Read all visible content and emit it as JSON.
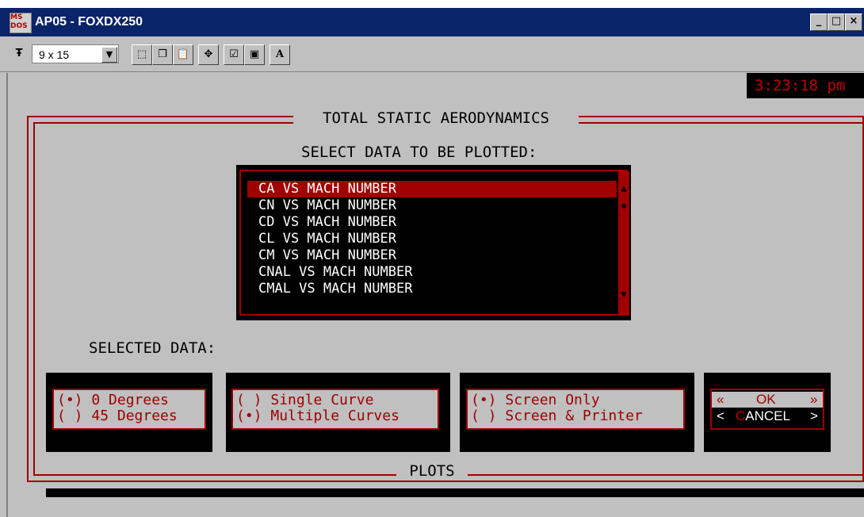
{
  "window": {
    "icon_text": "MS DOS",
    "title": "AP05 - FOXDX250",
    "controls": [
      "_",
      "□",
      "×"
    ]
  },
  "toolbar": {
    "font_icon": "Ŧ",
    "font_size": "9 x 15",
    "tools": [
      "select-icon",
      "copy-icon",
      "paste-icon",
      "fullscreen-icon",
      "properties-icon",
      "background-icon",
      "font-icon"
    ]
  },
  "clock": "3:23:18 pm",
  "dialog": {
    "title": "TOTAL STATIC AERODYNAMICS",
    "prompt": "SELECT DATA TO BE PLOTTED:",
    "list_items": [
      "CA VS MACH NUMBER",
      "CN VS MACH NUMBER",
      "CD VS MACH NUMBER",
      "CL VS MACH NUMBER",
      "CM VS MACH NUMBER",
      "CNAL VS MACH NUMBER",
      "CMAL VS MACH NUMBER"
    ],
    "selected_index": 0,
    "selected_data_label": "SELECTED DATA:",
    "angle_options": [
      {
        "marker": "(•)",
        "label": "0 Degrees"
      },
      {
        "marker": "( )",
        "label": "45 Degrees"
      }
    ],
    "curve_options": [
      {
        "marker": "( )",
        "label": "Single Curve"
      },
      {
        "marker": "(•)",
        "label": "Multiple Curves"
      }
    ],
    "output_options": [
      {
        "marker": "(•)",
        "label": "Screen Only"
      },
      {
        "marker": "( )",
        "label": "Screen & Printer"
      }
    ],
    "ok": {
      "left": "«",
      "label": "OK",
      "right": "»"
    },
    "cancel": {
      "left": "<",
      "hotkey": "C",
      "label": "ANCEL",
      "right": ">"
    },
    "footer": "PLOTS"
  },
  "colors": {
    "accent": "#a00000",
    "clock": "#c00000",
    "titlebar": "#0a246a"
  }
}
